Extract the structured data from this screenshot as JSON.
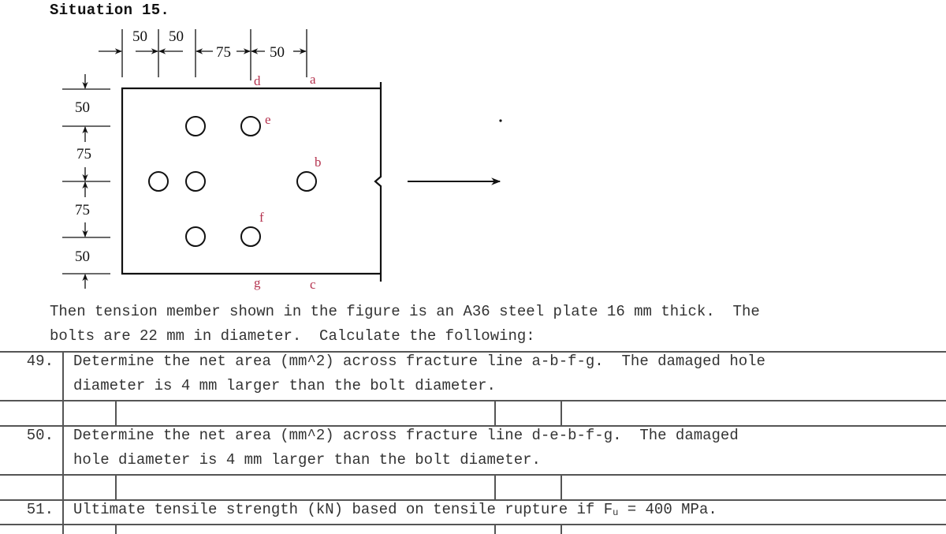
{
  "document": {
    "title": "Situation 15.",
    "intro_line1": "Then tension member shown in the figure is an A36 steel plate 16 mm thick.  The",
    "intro_line2": "bolts are 22 mm in diameter.  Calculate the following:"
  },
  "figure": {
    "top_dimensions": [
      "50",
      "50",
      "75",
      "50"
    ],
    "left_dimensions": [
      "50",
      "75",
      "75",
      "50"
    ],
    "point_labels": {
      "a": "a",
      "b": "b",
      "c": "c",
      "d": "d",
      "e": "e",
      "f": "f",
      "g": "g"
    },
    "label_color": "#b5334f",
    "load_arrow": "tension-direction-right"
  },
  "questions": [
    {
      "number": "49.",
      "line1": "Determine the net area (mm^2) across fracture line a-b-f-g.  The damaged hole",
      "line2": "diameter is 4 mm larger than the bolt diameter."
    },
    {
      "number": "50.",
      "line1": "Determine the net area (mm^2) across fracture line d-e-b-f-g.  The damaged",
      "line2": "hole diameter is 4 mm larger than the bolt diameter."
    },
    {
      "number": "51.",
      "line1_pre": "Ultimate tensile strength (kN) based on tensile rupture if F",
      "line1_sub": "u",
      "line1_post": " = 400 MPa."
    }
  ]
}
